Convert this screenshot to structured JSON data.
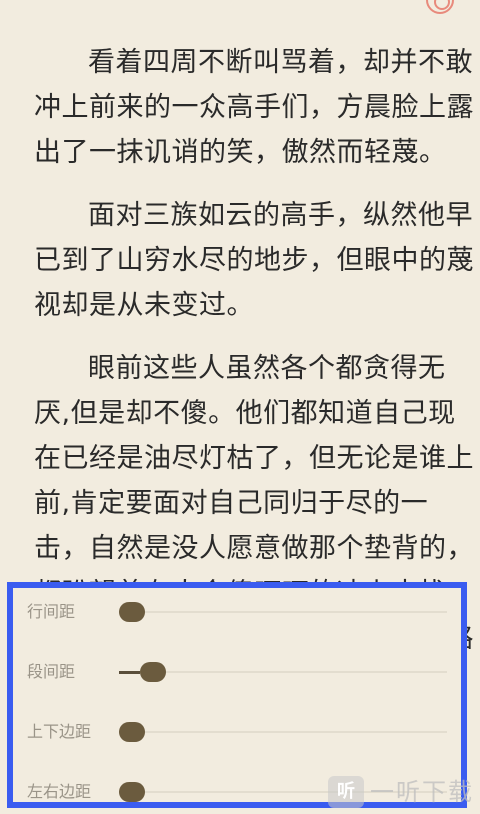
{
  "article": {
    "paragraphs": [
      "看着四周不断叫骂着，却并不敢冲上前来的一众高手们，方晨脸上露出了一抹讥诮的笑，傲然而轻蔑。",
      "面对三族如云的高手，纵然他早已到了山穷水尽的地步，但眼中的蔑视却是从未变过。",
      "眼前这些人虽然各个都贪得无厌,但是却不傻。他们都知道自己现在已经是油尽灯枯了，但无论是谁上前,肯定要面对自己同归于尽的一击，自然是没人愿意做那个垫背的，都盼望着有人会傻呵呵的冲上来找死，但却谁也不傻，所以他们便五路在这个时"
    ]
  },
  "settings": {
    "line_spacing": {
      "label": "行间距",
      "level": 0.0
    },
    "paragraph_spacing": {
      "label": "段间距",
      "level": 0.07
    },
    "vertical_margin": {
      "label": "上下边距",
      "level": 0.0
    },
    "horizontal_margin": {
      "label": "左右边距",
      "level": 0.0
    }
  },
  "watermark": {
    "text": "一听下载",
    "icon_glyph": "听"
  },
  "colors": {
    "highlight_border": "#3a5cf0",
    "knob": "#6b5b3e",
    "background": "#f2ecdf"
  }
}
